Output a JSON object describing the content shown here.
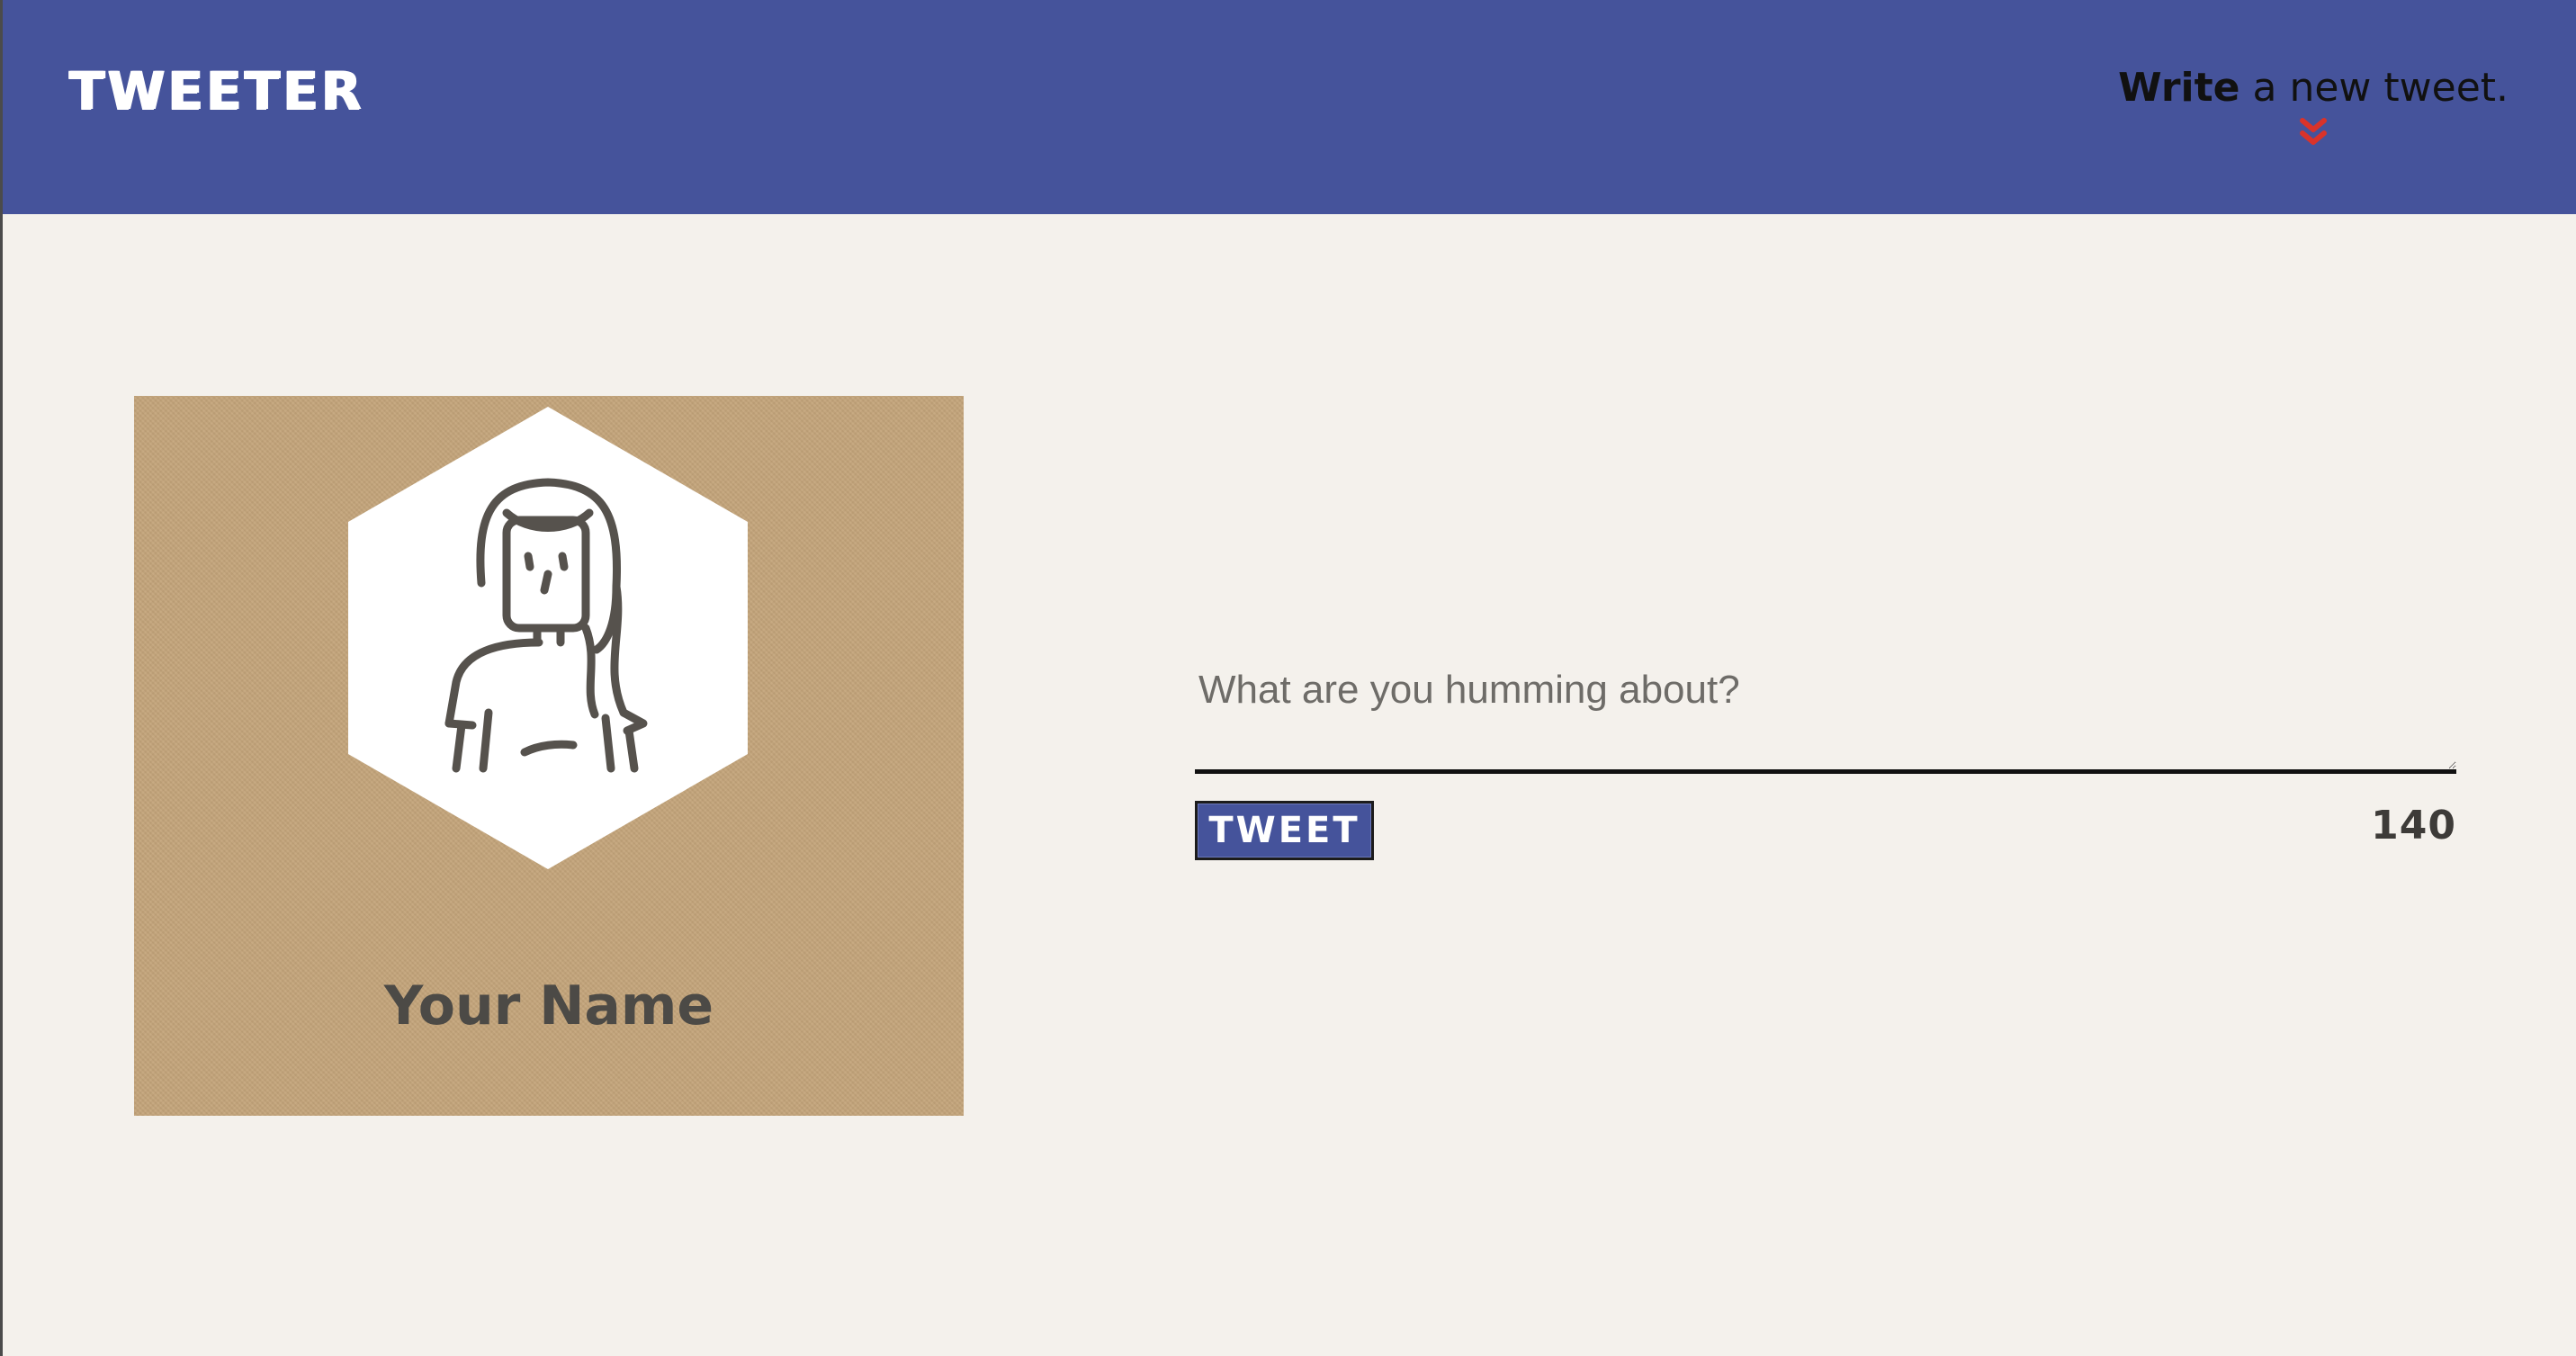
{
  "header": {
    "logo": "TWEETER",
    "compose_strong": "Write",
    "compose_rest": " a new tweet.",
    "toggle_icon": "double-chevron-down-icon",
    "bg_color": "#45539b",
    "accent_color": "#d9332a"
  },
  "profile": {
    "name": "Your Name",
    "avatar_icon": "woman-avatar-icon",
    "card_color": "#c4a57b"
  },
  "composer": {
    "placeholder": "What are you humming about?",
    "value": "",
    "tweet_label": "TWEET",
    "char_count": "140"
  }
}
